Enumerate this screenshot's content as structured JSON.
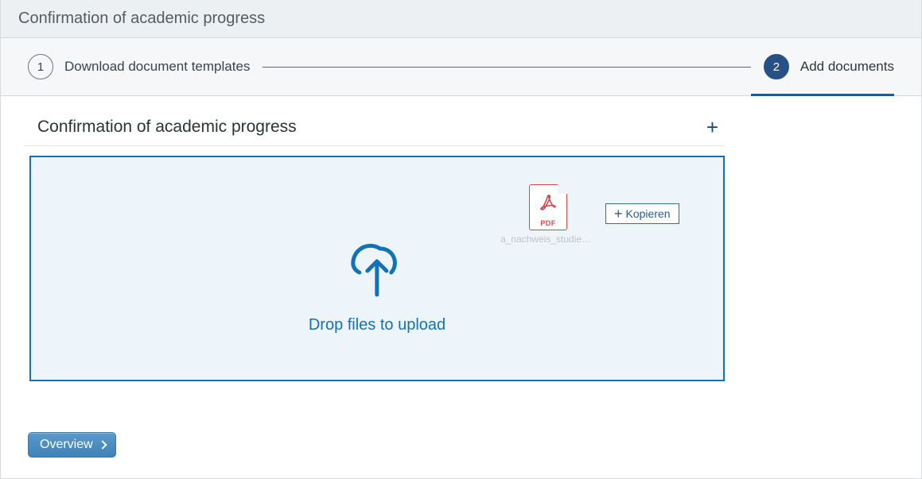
{
  "title": "Confirmation of academic progress",
  "wizard": {
    "steps": [
      {
        "num": "1",
        "label": "Download document templates",
        "active": false
      },
      {
        "num": "2",
        "label": "Add documents",
        "active": true
      }
    ]
  },
  "panel": {
    "heading": "Confirmation of academic progress",
    "drop_label": "Drop files to upload"
  },
  "drag": {
    "filename": "a_nachweis_studien…",
    "pdf_label": "PDF",
    "copy_label": "Kopieren"
  },
  "footer": {
    "overview_label": "Overview"
  }
}
